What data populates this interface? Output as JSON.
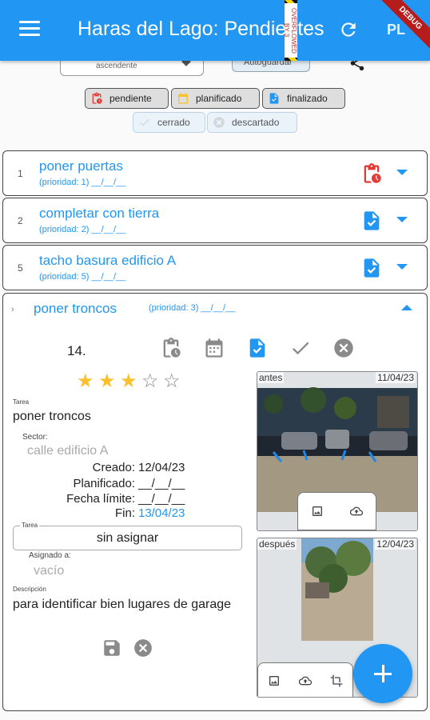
{
  "appbar": {
    "title": "Haras del Lago: Pendientes",
    "extra": "PL",
    "overflow_note": "OVERFLOWED BY 3",
    "debug_label": "DEBUG"
  },
  "sort": {
    "label": "ascendente",
    "autosave_label": "Autoguardar"
  },
  "filters": [
    {
      "label": "pendiente",
      "active": true
    },
    {
      "label": "planificado",
      "active": true
    },
    {
      "label": "finalizado",
      "active": true
    },
    {
      "label": "cerrado",
      "active": false
    },
    {
      "label": "descartado",
      "active": false
    }
  ],
  "tasks": [
    {
      "num": "1",
      "title": "poner puertas",
      "sub": "(prioridad: 1) __/__/__",
      "status": "pendiente"
    },
    {
      "num": "2",
      "title": "completar con tierra",
      "sub": "(prioridad: 2) __/__/__",
      "status": "finalizado"
    },
    {
      "num": "5",
      "title": "tacho basura edificio A",
      "sub": "(prioridad: 5) __/__/__",
      "status": "finalizado"
    }
  ],
  "expanded": {
    "arrow": "›",
    "title": "poner troncos",
    "sub": "(prioridad: 3) __/__/__",
    "number": "14.",
    "rating": 3,
    "rating_max": 5,
    "tarea_label": "Tarea",
    "tarea_value": "poner troncos",
    "sector_label": "Sector:",
    "sector_value": "calle edificio A",
    "creado_label": "Creado:",
    "creado_value": "12/04/23",
    "planificado_label": "Planificado:",
    "planificado_value": "__/__/__",
    "limite_label": "Fecha límite:",
    "limite_value": "__/__/__",
    "fin_label": "Fin:",
    "fin_value": "13/04/23",
    "assign_box_label": "Tarea",
    "assign_box_value": "sin asignar",
    "asignado_label": "Asignado a:",
    "asignado_value": "vacío",
    "desc_label": "Descripción",
    "desc_value": "para identificar bien lugares de garage",
    "photo_before": {
      "caption": "antes",
      "date": "11/04/23"
    },
    "photo_after": {
      "caption": "después",
      "date": "12/04/23"
    }
  },
  "colors": {
    "primary": "#2196f3",
    "pending_red": "#e53935",
    "star": "#fbc02d"
  }
}
